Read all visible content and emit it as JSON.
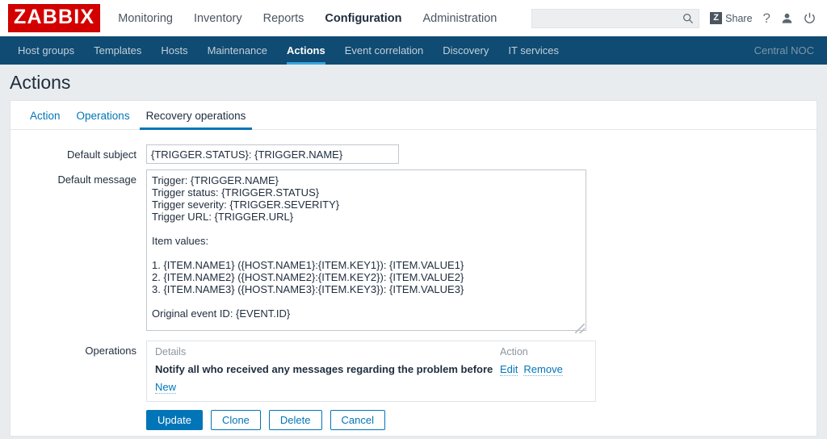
{
  "header": {
    "logo_text": "ZABBIX",
    "menu": [
      {
        "label": "Monitoring",
        "selected": false
      },
      {
        "label": "Inventory",
        "selected": false
      },
      {
        "label": "Reports",
        "selected": false
      },
      {
        "label": "Configuration",
        "selected": true
      },
      {
        "label": "Administration",
        "selected": false
      }
    ],
    "search": {
      "value": "",
      "placeholder": ""
    },
    "share_label": "Share",
    "share_badge": "Z",
    "help_label": "?"
  },
  "subnav": {
    "items": [
      {
        "label": "Host groups",
        "selected": false
      },
      {
        "label": "Templates",
        "selected": false
      },
      {
        "label": "Hosts",
        "selected": false
      },
      {
        "label": "Maintenance",
        "selected": false
      },
      {
        "label": "Actions",
        "selected": true
      },
      {
        "label": "Event correlation",
        "selected": false
      },
      {
        "label": "Discovery",
        "selected": false
      },
      {
        "label": "IT services",
        "selected": false
      }
    ],
    "server_name": "Central NOC"
  },
  "page": {
    "title": "Actions"
  },
  "tabs": [
    {
      "label": "Action",
      "selected": false
    },
    {
      "label": "Operations",
      "selected": false
    },
    {
      "label": "Recovery operations",
      "selected": true
    }
  ],
  "form": {
    "default_subject": {
      "label": "Default subject",
      "value": "{TRIGGER.STATUS}: {TRIGGER.NAME}"
    },
    "default_message": {
      "label": "Default message",
      "value": "Trigger: {TRIGGER.NAME}\nTrigger status: {TRIGGER.STATUS}\nTrigger severity: {TRIGGER.SEVERITY}\nTrigger URL: {TRIGGER.URL}\n\nItem values:\n\n1. {ITEM.NAME1} ({HOST.NAME1}:{ITEM.KEY1}): {ITEM.VALUE1}\n2. {ITEM.NAME2} ({HOST.NAME2}:{ITEM.KEY2}): {ITEM.VALUE2}\n3. {ITEM.NAME3} ({HOST.NAME3}:{ITEM.KEY3}): {ITEM.VALUE3}\n\nOriginal event ID: {EVENT.ID}"
    },
    "operations": {
      "label": "Operations",
      "columns": {
        "details": "Details",
        "action": "Action"
      },
      "rows": [
        {
          "details": "Notify all who received any messages regarding the problem before",
          "edit_label": "Edit",
          "remove_label": "Remove"
        }
      ],
      "new_label": "New"
    }
  },
  "buttons": {
    "update": "Update",
    "clone": "Clone",
    "delete": "Delete",
    "cancel": "Cancel"
  },
  "colors": {
    "brand_red": "#d40000",
    "nav_dark": "#0f4b72",
    "accent_blue": "#0275b8",
    "page_bg": "#e8ecef"
  }
}
